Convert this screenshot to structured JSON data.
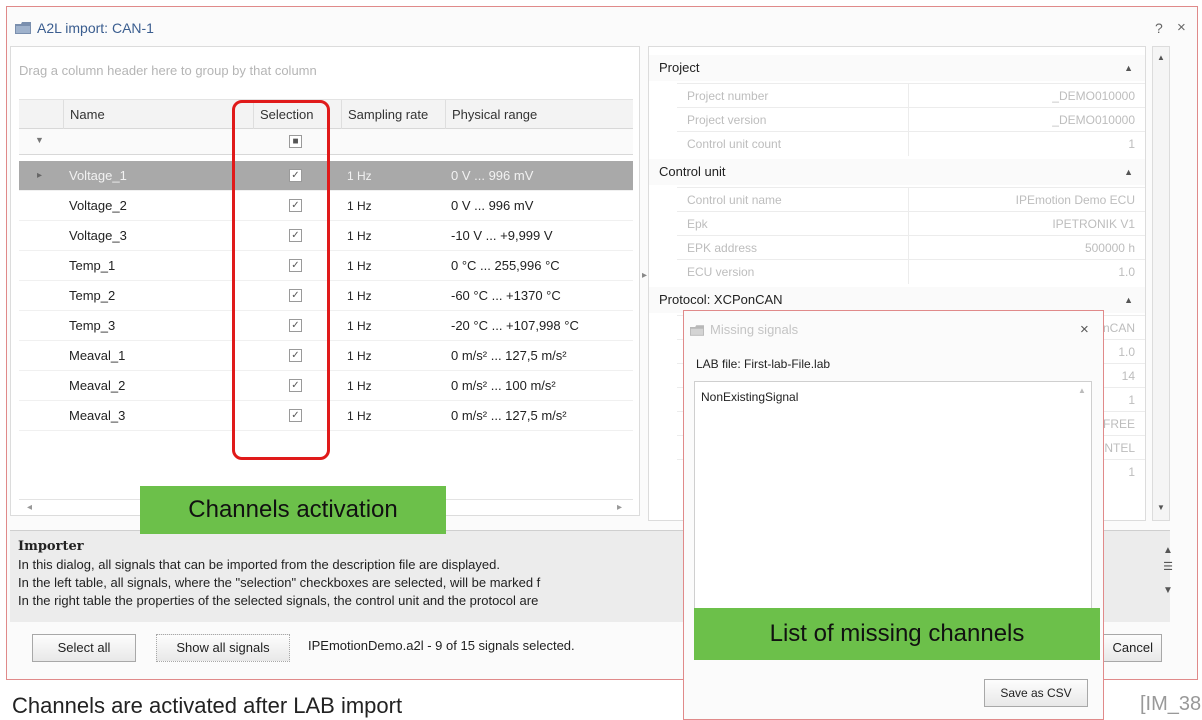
{
  "dialog": {
    "title": "A2L import: CAN-1",
    "help_label": "?",
    "close_label": "×"
  },
  "grid": {
    "group_hint": "Drag a column header here to group by that column",
    "columns": {
      "name": "Name",
      "selection": "Selection",
      "rate": "Sampling rate",
      "range": "Physical range"
    },
    "filter_icon": "▼",
    "row_indicator": "▸",
    "rows": [
      {
        "name": "Voltage_1",
        "rate": "1 Hz",
        "range": "0 V ... 996 mV",
        "checked": true
      },
      {
        "name": "Voltage_2",
        "rate": "1 Hz",
        "range": "0 V ... 996 mV",
        "checked": true
      },
      {
        "name": "Voltage_3",
        "rate": "1 Hz",
        "range": "-10 V ... +9,999 V",
        "checked": true
      },
      {
        "name": "Temp_1",
        "rate": "1 Hz",
        "range": "0 °C ... 255,996 °C",
        "checked": true
      },
      {
        "name": "Temp_2",
        "rate": "1 Hz",
        "range": "-60 °C ... +1370 °C",
        "checked": true
      },
      {
        "name": "Temp_3",
        "rate": "1 Hz",
        "range": "-20 °C ... +107,998 °C",
        "checked": true
      },
      {
        "name": "Meaval_1",
        "rate": "1 Hz",
        "range": "0 m/s² ... 127,5 m/s²",
        "checked": true
      },
      {
        "name": "Meaval_2",
        "rate": "1 Hz",
        "range": "0 m/s² ... 100 m/s²",
        "checked": true
      },
      {
        "name": "Meaval_3",
        "rate": "1 Hz",
        "range": "0 m/s² ... 127,5 m/s²",
        "checked": true
      }
    ],
    "scroll_left": "◂",
    "scroll_right": "▸"
  },
  "properties": {
    "project": {
      "title": "Project",
      "items": [
        {
          "key": "Project number",
          "value": "_DEMO010000"
        },
        {
          "key": "Project version",
          "value": "_DEMO010000"
        },
        {
          "key": "Control unit count",
          "value": "1"
        }
      ]
    },
    "control_unit": {
      "title": "Control unit",
      "items": [
        {
          "key": "Control unit name",
          "value": "IPEmotion Demo ECU"
        },
        {
          "key": "Epk",
          "value": "IPETRONIK V1"
        },
        {
          "key": "EPK address",
          "value": "500000 h"
        },
        {
          "key": "ECU version",
          "value": "1.0"
        }
      ]
    },
    "protocol": {
      "title": "Protocol: XCPonCAN",
      "values": [
        "onCAN",
        "1.0",
        "14",
        "1",
        "FREE",
        "INTEL",
        "1"
      ]
    },
    "collapse_icon": "▲"
  },
  "importer": {
    "title": "Importer",
    "lines": [
      "In this dialog, all signals that can be imported from the description file are displayed.",
      "In the left table, all signals, where the \"selection\" checkboxes are selected, will be marked f",
      "In the right table the properties of the selected signals, the control unit and the protocol are"
    ]
  },
  "footer": {
    "select_all": "Select all",
    "show_all": "Show all signals",
    "status": "IPEmotionDemo.a2l  -  9 of 15 signals selected.",
    "cancel": "Cancel"
  },
  "popup": {
    "title": "Missing signals",
    "close_label": "×",
    "lab_file": "LAB file: First-lab-File.lab",
    "missing": [
      "NonExistingSignal"
    ],
    "save_csv": "Save as CSV"
  },
  "annotations": {
    "channels_activation": "Channels activation",
    "missing_channels": "List of missing channels",
    "caption": "Channels are activated after LAB import",
    "ref": "[IM_38"
  },
  "colors": {
    "highlight_red": "#e01a1a",
    "label_green": "#6cc04a",
    "selected_row": "#a9a9a9",
    "title_blue": "#3a5d8f"
  }
}
